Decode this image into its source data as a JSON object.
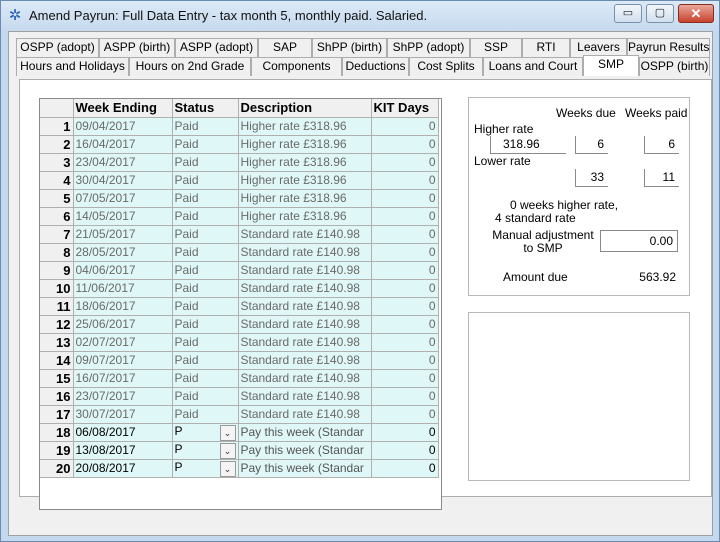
{
  "window": {
    "title": "Amend Payrun: Full Data Entry - tax month 5, monthly paid.  Salaried.",
    "buttons": {
      "minimize": "▭",
      "maximize": "▢",
      "close": "✕"
    }
  },
  "tabs": {
    "row_top": [
      "OSPP (adopt)",
      "ASPP (birth)",
      "ASPP (adopt)",
      "SAP",
      "ShPP (birth)",
      "ShPP (adopt)",
      "SSP",
      "RTI",
      "Leavers",
      "Payrun Results"
    ],
    "row_bottom": [
      "Hours and Holidays",
      "Hours on 2nd Grade",
      "Components",
      "Deductions",
      "Cost Splits",
      "Loans and Court",
      "SMP",
      "OSPP (birth)"
    ],
    "active": "SMP"
  },
  "grid": {
    "headers": [
      "Week Ending",
      "Status",
      "Description",
      "KIT Days"
    ],
    "rows": [
      {
        "n": "1",
        "week": "09/04/2017",
        "status": "Paid",
        "desc": "Higher rate £318.96",
        "kit": "0"
      },
      {
        "n": "2",
        "week": "16/04/2017",
        "status": "Paid",
        "desc": "Higher rate £318.96",
        "kit": "0"
      },
      {
        "n": "3",
        "week": "23/04/2017",
        "status": "Paid",
        "desc": "Higher rate £318.96",
        "kit": "0"
      },
      {
        "n": "4",
        "week": "30/04/2017",
        "status": "Paid",
        "desc": "Higher rate £318.96",
        "kit": "0"
      },
      {
        "n": "5",
        "week": "07/05/2017",
        "status": "Paid",
        "desc": "Higher rate £318.96",
        "kit": "0"
      },
      {
        "n": "6",
        "week": "14/05/2017",
        "status": "Paid",
        "desc": "Higher rate £318.96",
        "kit": "0"
      },
      {
        "n": "7",
        "week": "21/05/2017",
        "status": "Paid",
        "desc": "Standard rate £140.98",
        "kit": "0"
      },
      {
        "n": "8",
        "week": "28/05/2017",
        "status": "Paid",
        "desc": "Standard rate £140.98",
        "kit": "0"
      },
      {
        "n": "9",
        "week": "04/06/2017",
        "status": "Paid",
        "desc": "Standard rate £140.98",
        "kit": "0"
      },
      {
        "n": "10",
        "week": "11/06/2017",
        "status": "Paid",
        "desc": "Standard rate £140.98",
        "kit": "0"
      },
      {
        "n": "11",
        "week": "18/06/2017",
        "status": "Paid",
        "desc": "Standard rate £140.98",
        "kit": "0"
      },
      {
        "n": "12",
        "week": "25/06/2017",
        "status": "Paid",
        "desc": "Standard rate £140.98",
        "kit": "0"
      },
      {
        "n": "13",
        "week": "02/07/2017",
        "status": "Paid",
        "desc": "Standard rate £140.98",
        "kit": "0"
      },
      {
        "n": "14",
        "week": "09/07/2017",
        "status": "Paid",
        "desc": "Standard rate £140.98",
        "kit": "0"
      },
      {
        "n": "15",
        "week": "16/07/2017",
        "status": "Paid",
        "desc": "Standard rate £140.98",
        "kit": "0"
      },
      {
        "n": "16",
        "week": "23/07/2017",
        "status": "Paid",
        "desc": "Standard rate £140.98",
        "kit": "0"
      },
      {
        "n": "17",
        "week": "30/07/2017",
        "status": "Paid",
        "desc": "Standard rate £140.98",
        "kit": "0"
      },
      {
        "n": "18",
        "week": "06/08/2017",
        "status": "P",
        "desc": "Pay this week (Standar",
        "kit": "0",
        "open": true
      },
      {
        "n": "19",
        "week": "13/08/2017",
        "status": "P",
        "desc": "Pay this week (Standar",
        "kit": "0",
        "open": true
      },
      {
        "n": "20",
        "week": "20/08/2017",
        "status": "P",
        "desc": "Pay this week (Standar",
        "kit": "0",
        "open": true
      }
    ],
    "dropdown_icon": "chevron-down-icon"
  },
  "smp_panel": {
    "weeks_due_label": "Weeks due",
    "weeks_paid_label": "Weeks paid",
    "higher_rate_label": "Higher rate",
    "higher_rate_value": "318.96",
    "higher_weeks_due": "6",
    "higher_weeks_paid": "6",
    "lower_rate_label": "Lower rate",
    "lower_weeks_due": "33",
    "lower_weeks_paid": "11",
    "summary_line1": "0 weeks higher rate,",
    "summary_line2": "4 standard rate",
    "manual_adj_label1": "Manual adjustment",
    "manual_adj_label2": "to SMP",
    "manual_adj_value": "0.00",
    "amount_due_label": "Amount due",
    "amount_due_value": "563.92"
  }
}
